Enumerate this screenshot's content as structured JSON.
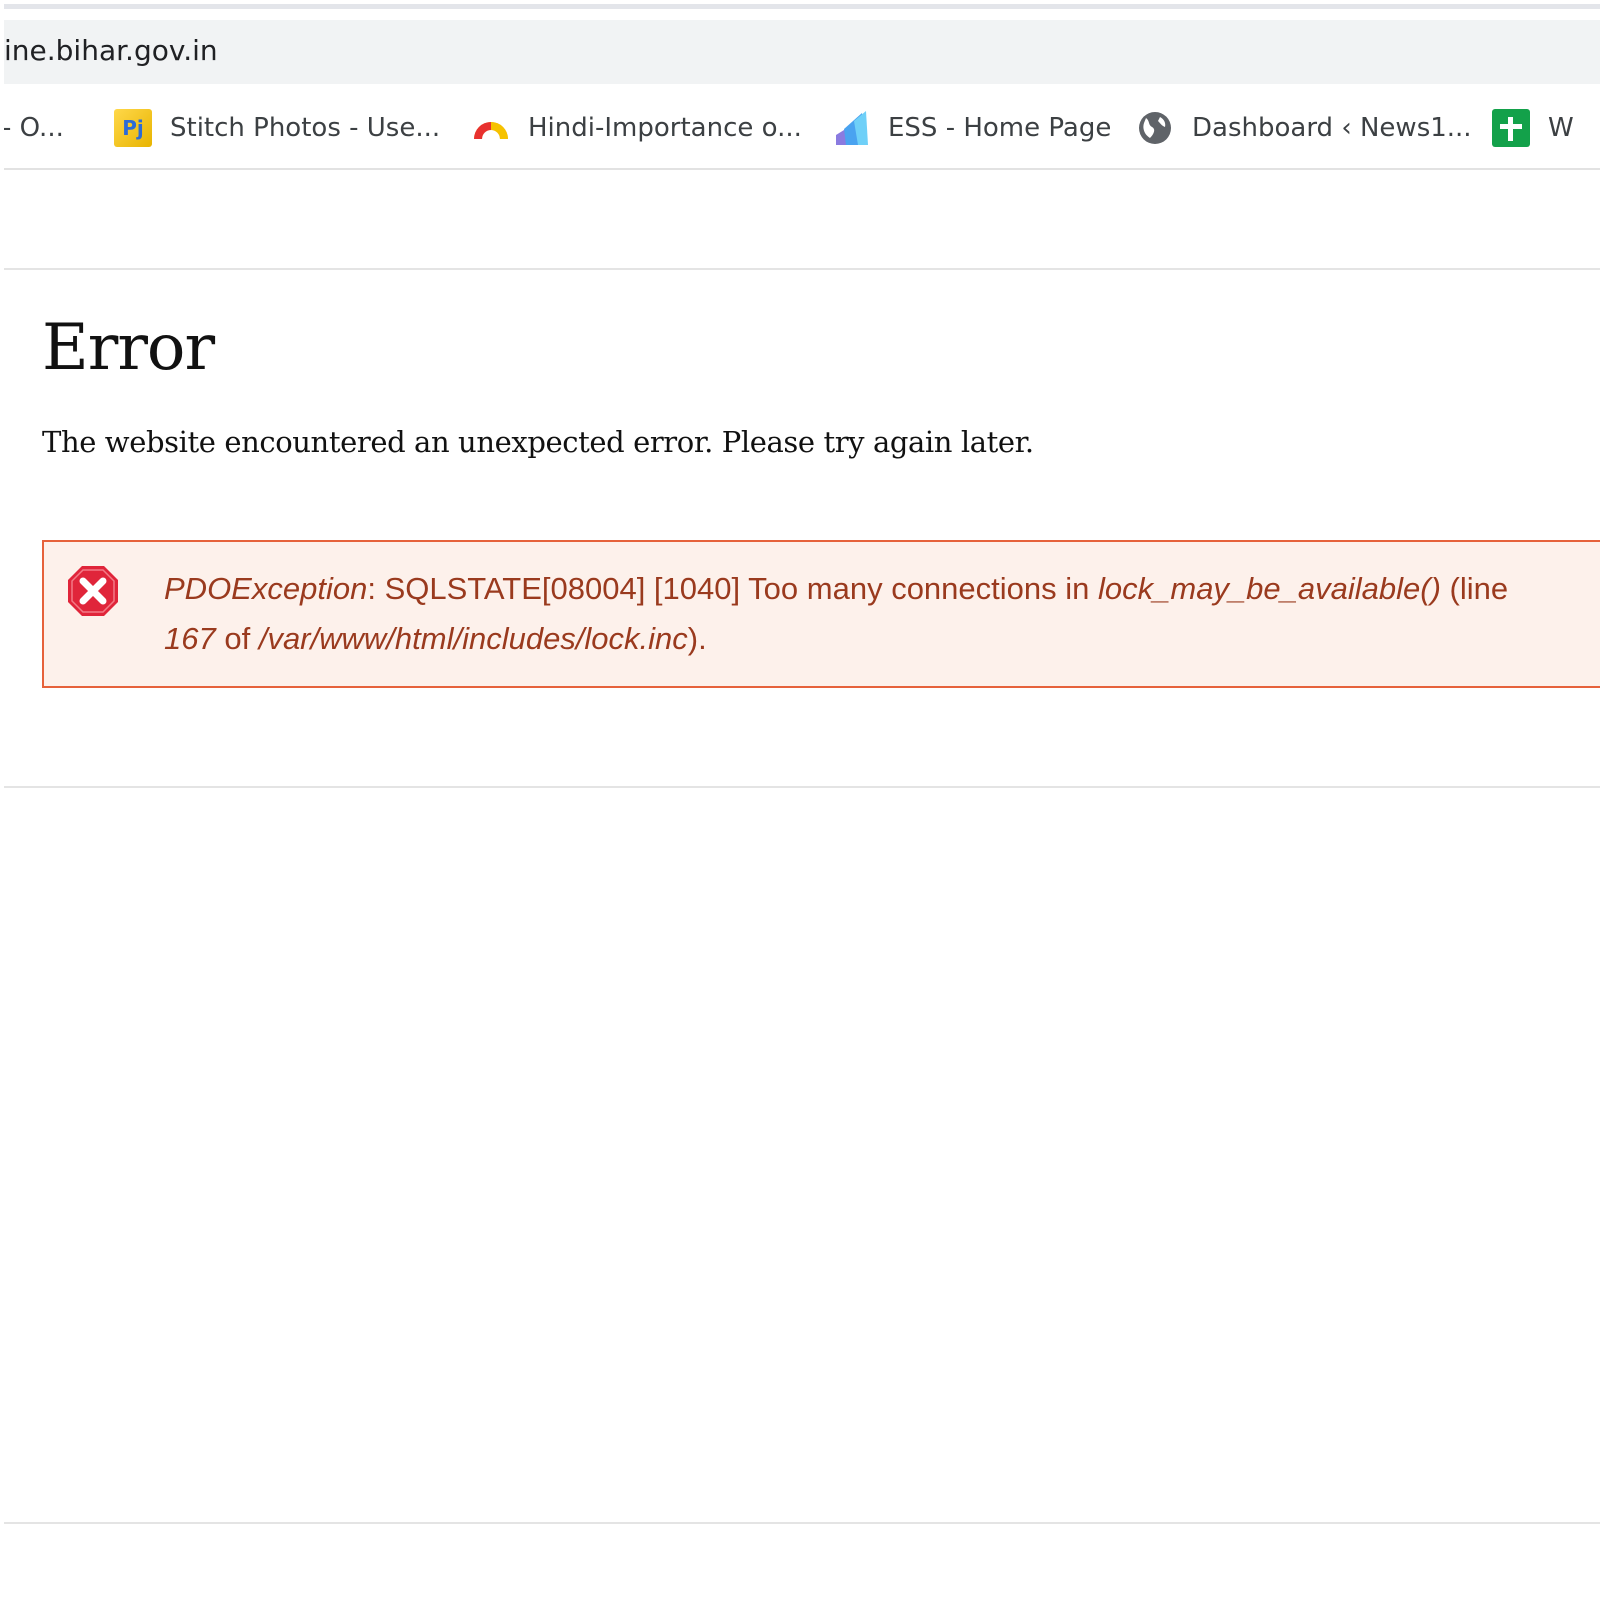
{
  "browser": {
    "address": "ine.bihar.gov.in",
    "bookmarks": [
      {
        "label": "- O...",
        "icon": "none"
      },
      {
        "label": "Stitch Photos - Use...",
        "icon": "pj-app-icon"
      },
      {
        "label": "Hindi-Importance o...",
        "icon": "rainbow-arc-icon"
      },
      {
        "label": "ESS - Home Page",
        "icon": "ess-logo-icon"
      },
      {
        "label": "Dashboard ‹ News1...",
        "icon": "globe-icon"
      },
      {
        "label": "W",
        "icon": "green-plus-icon"
      }
    ]
  },
  "page": {
    "title": "Error",
    "description": "The website encountered an unexpected error. Please try again later.",
    "error": {
      "exception": "PDOException",
      "sep": ": ",
      "message": "SQLSTATE[08004] [1040] Too many connections in ",
      "function": "lock_may_be_available()",
      "line_prefix": " (line",
      "line_number": "167",
      "of": " of ",
      "file": "/var/www/html/includes/lock.inc",
      "suffix": ")."
    },
    "colors": {
      "error_border": "#e6623b",
      "error_background": "#fdf1eb",
      "error_text": "#9a3a1e",
      "error_icon": "#e0253a"
    }
  }
}
